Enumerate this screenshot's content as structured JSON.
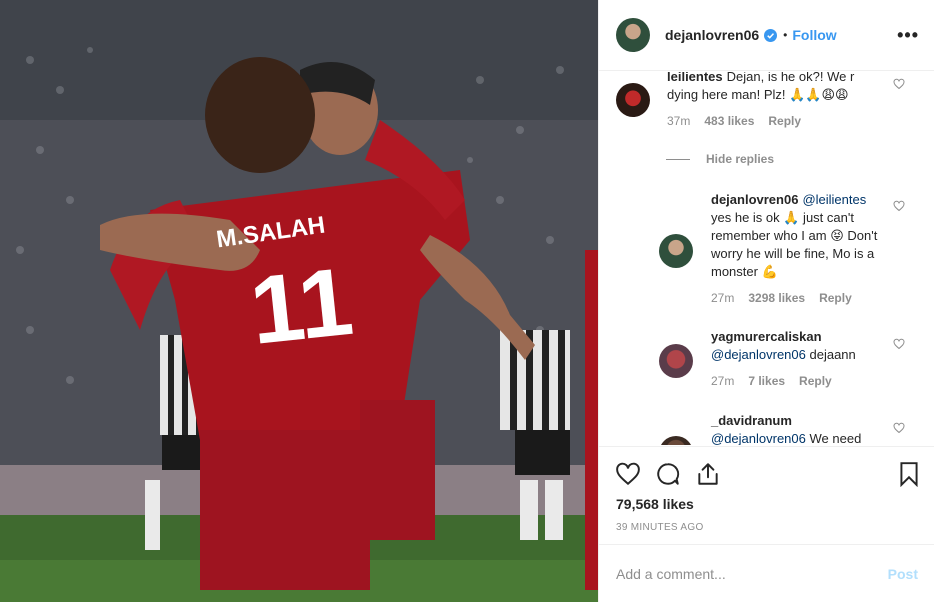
{
  "header": {
    "username": "dejanlovren06",
    "separator": "•",
    "follow_label": "Follow",
    "more_label": "•••"
  },
  "photo": {
    "jersey_name": "M.SALAH",
    "jersey_number": "11"
  },
  "comments": [
    {
      "username": "leilientes",
      "text": "Dejan, is he ok?! We r dying here man! Plz! 🙏🙏😩😩",
      "time": "37m",
      "likes": "483 likes",
      "reply_label": "Reply"
    },
    {
      "username": "dejanlovren06",
      "mention": "@leilientes",
      "text": "yes he is ok 🙏 just can't remember who I am 😝 Don't worry he will be fine, Mo is a monster 💪",
      "time": "27m",
      "likes": "3298 likes",
      "reply_label": "Reply"
    },
    {
      "username": "yagmurercaliskan",
      "mention": "@dejanlovren06",
      "text": "dejaann",
      "time": "27m",
      "likes": "7 likes",
      "reply_label": "Reply"
    },
    {
      "username": "_davidranum",
      "mention": "@dejanlovren06",
      "text": "We need"
    }
  ],
  "hide_replies_label": "Hide replies",
  "post": {
    "likes": "79,568 likes",
    "timestamp": "39 MINUTES AGO"
  },
  "add_comment": {
    "placeholder": "Add a comment...",
    "post_label": "Post"
  },
  "colors": {
    "link": "#3897f0",
    "mention": "#003569",
    "muted": "#8e8e8e",
    "post_disabled": "#b2dffc",
    "jersey_red": "#a8141e"
  }
}
